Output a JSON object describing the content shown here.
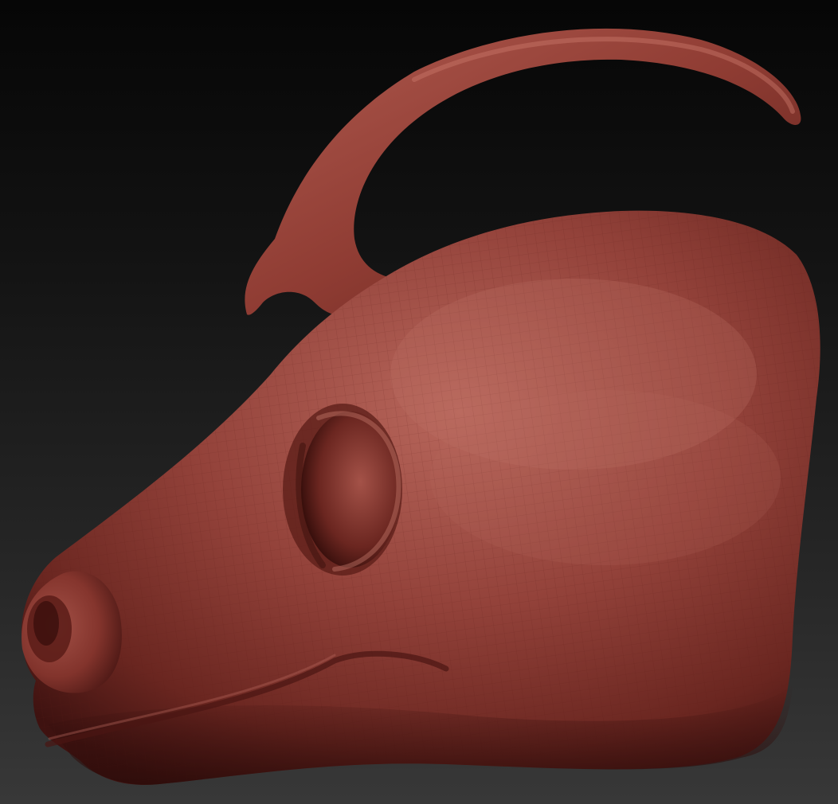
{
  "scene": {
    "subject": "",
    "colors": {
      "background_top": "#060606",
      "background_bottom": "#383838",
      "clay_base": "#8a3a30",
      "clay_highlight": "#b8675c",
      "clay_shadow": "#3e1210",
      "wire_line": "#5a1d17"
    }
  }
}
